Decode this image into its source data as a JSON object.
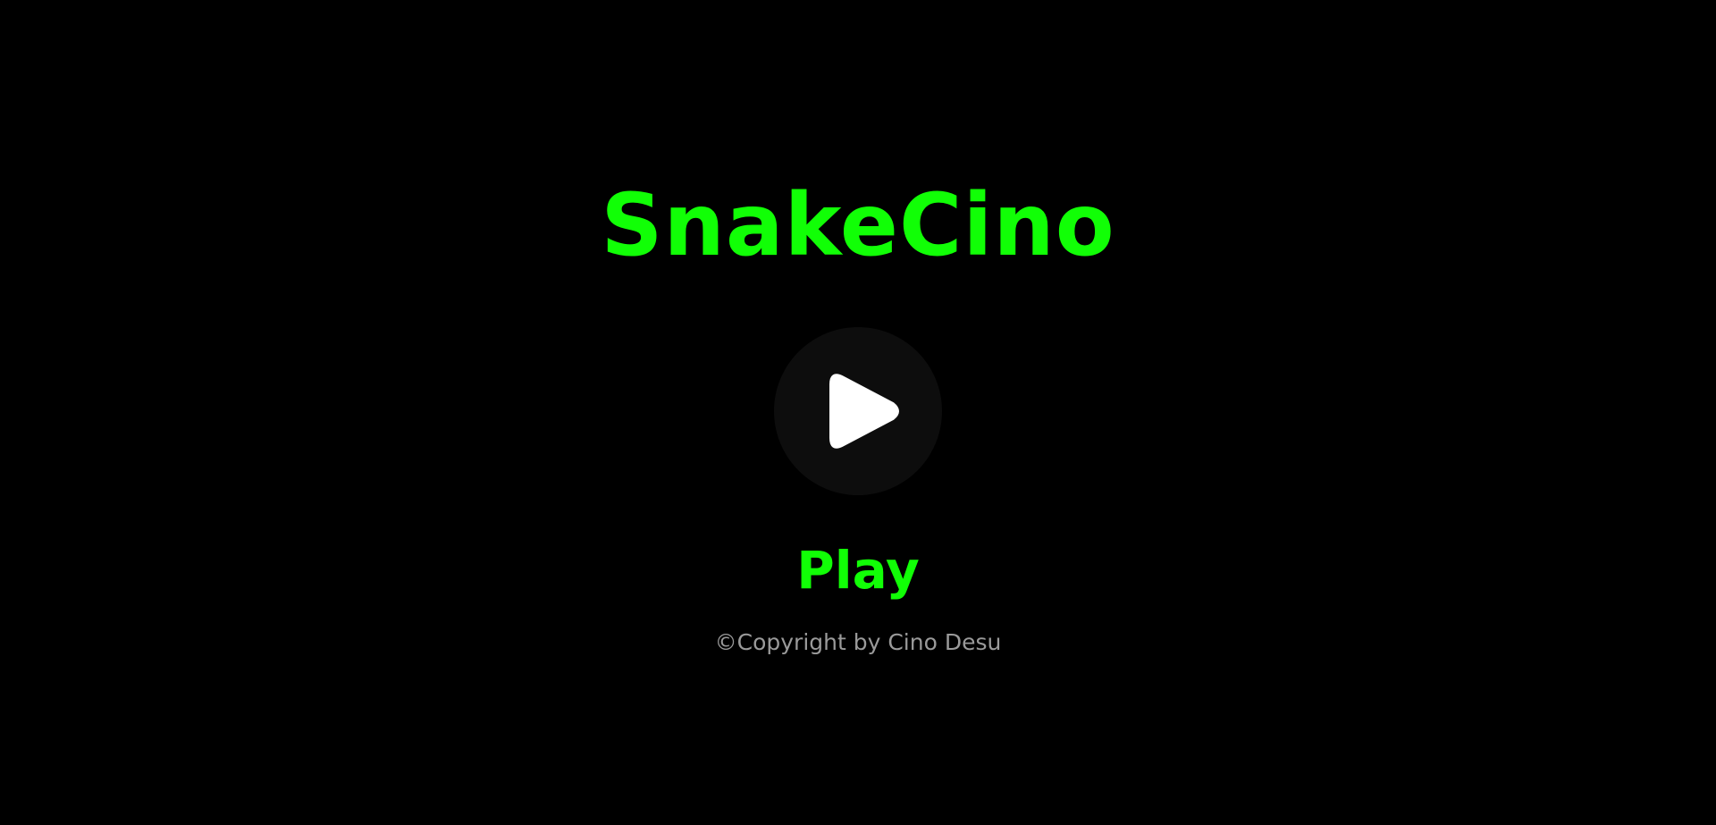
{
  "game": {
    "title": "SnakeCino",
    "play_label": "Play",
    "copyright": "©Copyright by Cino Desu"
  },
  "icons": {
    "play": "play-triangle-icon"
  },
  "colors": {
    "background": "#000000",
    "accent": "#11ff06",
    "button_bg": "#0d0d0d",
    "icon": "#ffffff",
    "muted_text": "#9a9a9a"
  }
}
